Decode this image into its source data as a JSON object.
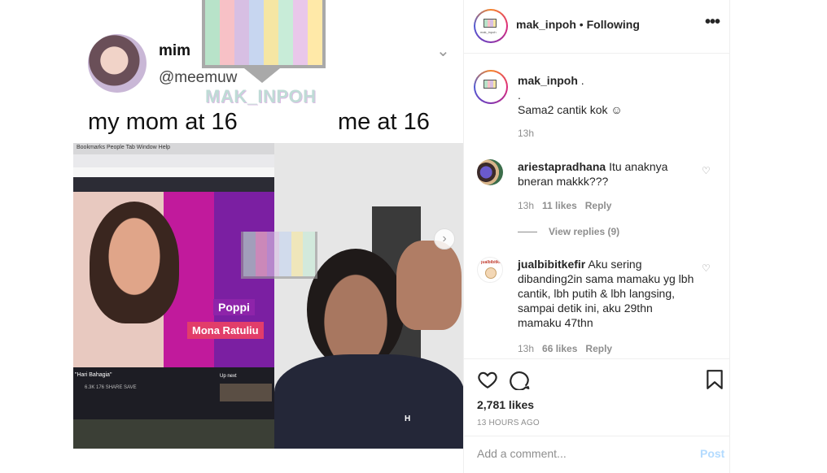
{
  "post_image": {
    "tweet": {
      "display_name": "mim",
      "handle": "@meemuw",
      "caption_left": "my mom at 16",
      "caption_right": "me at 16"
    },
    "watermark_text": "MAK_INPOH",
    "watermark_colors": [
      "#b8e3c9",
      "#f7c1c6",
      "#d7bfe3",
      "#c7d6f0",
      "#f5e6a3",
      "#c8ecd8",
      "#e9c7ea",
      "#ffe9a8"
    ],
    "left_photo": {
      "browser_menu": "Bookmarks   People   Tab   Window   Help",
      "video_title": "\"Hari Bahagia\"",
      "video_stats": "6.3K    176    SHARE    SAVE",
      "up_next": "Up next",
      "name_label_1": "Poppi",
      "name_label_2": "Mona Ratuliu"
    },
    "right_photo": {
      "shirt_text": "H"
    },
    "next_button": "›"
  },
  "header": {
    "username": "mak_inpoh",
    "separator": "•",
    "follow_status": "Following",
    "more_icon": "•••",
    "avatar_label": "mak_inpoh"
  },
  "comments": [
    {
      "username": "mak_inpoh",
      "suffix": " .",
      "lines": [
        ".",
        "Sama2 cantik kok ☺"
      ],
      "time": "13h"
    },
    {
      "username": "ariestapradhana",
      "text": "Itu anaknya bneran makkk???",
      "time": "13h",
      "likes": "11 likes",
      "reply": "Reply",
      "view_replies": "View replies (9)"
    },
    {
      "username": "jualbibitkefir",
      "text": "Aku sering dibanding2in sama mamaku yg lbh cantik, lbh putih & lbh langsing, sampai detik ini, aku 29thn mamaku 47thn",
      "time": "13h",
      "likes": "66 likes",
      "reply": "Reply",
      "avatar_text": "jualbibitkefir"
    }
  ],
  "actions": {
    "likes": "2,781 likes",
    "timestamp": "13 HOURS AGO"
  },
  "add_comment": {
    "placeholder": "Add a comment...",
    "post_label": "Post"
  }
}
